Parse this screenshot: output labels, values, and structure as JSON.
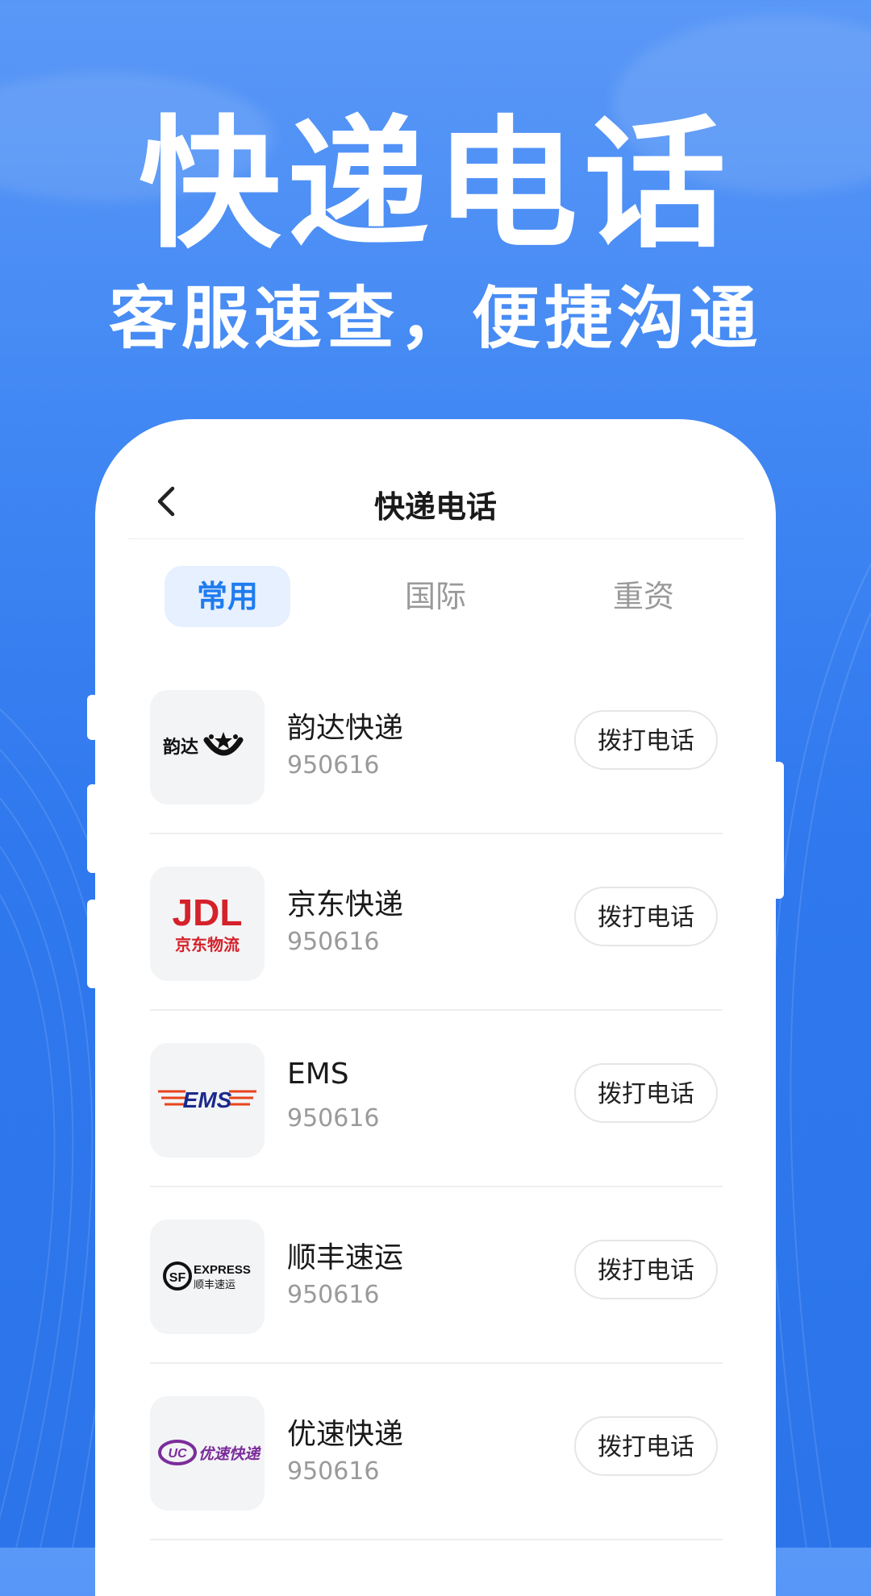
{
  "hero": {
    "title": "快递电话",
    "subtitle": "客服速查，便捷沟通"
  },
  "nav": {
    "back_icon": "chevron-left-icon",
    "title": "快递电话"
  },
  "tabs": [
    {
      "label": "常用",
      "active": true
    },
    {
      "label": "国际",
      "active": false
    },
    {
      "label": "重资",
      "active": false
    }
  ],
  "couriers": [
    {
      "name": "韵达快递",
      "phone": "950616",
      "call_label": "拨打电话",
      "logo": "yunda-logo",
      "logo_text": "韵达"
    },
    {
      "name": "京东快递",
      "phone": "950616",
      "call_label": "拨打电话",
      "logo": "jdl-logo",
      "logo_text": "JDL 京东物流"
    },
    {
      "name": "EMS",
      "phone": "950616",
      "call_label": "拨打电话",
      "logo": "ems-logo",
      "logo_text": "EMS"
    },
    {
      "name": "顺丰速运",
      "phone": "950616",
      "call_label": "拨打电话",
      "logo": "sf-express-logo",
      "logo_text": "SF EXPRESS 顺丰速运"
    },
    {
      "name": "优速快递",
      "phone": "950616",
      "call_label": "拨打电话",
      "logo": "uc-logo",
      "logo_text": "UC 优速快递"
    }
  ],
  "colors": {
    "background": "#3f86f3",
    "accent": "#1f7cf0",
    "tab_active_bg": "#e6f0ff"
  }
}
